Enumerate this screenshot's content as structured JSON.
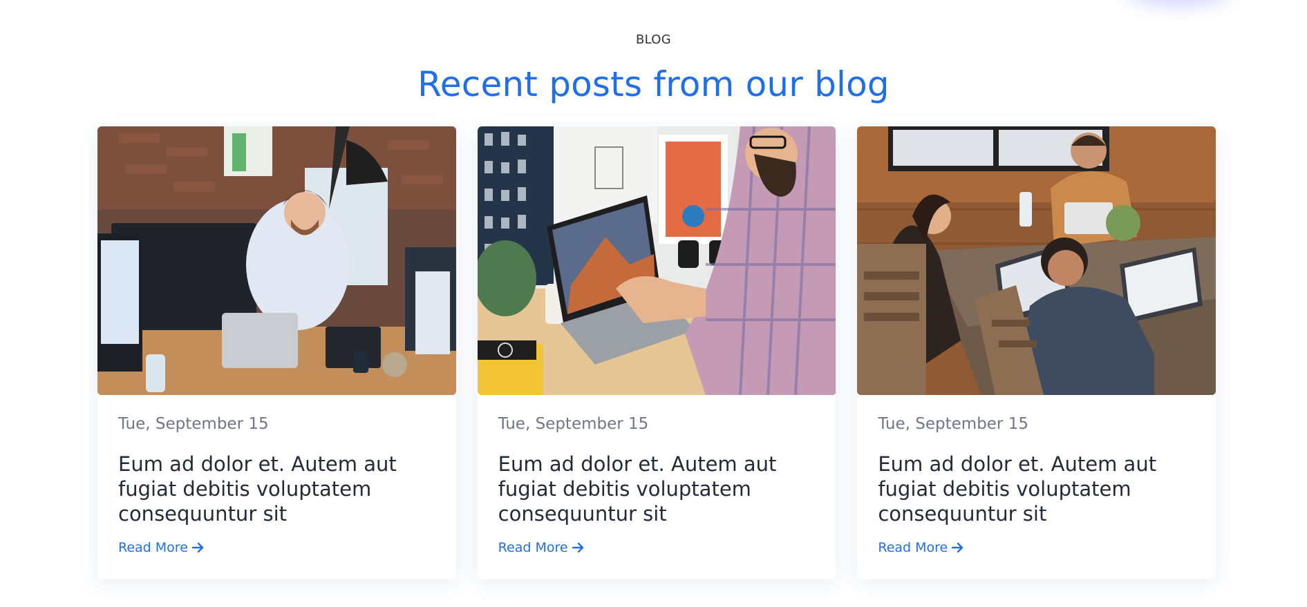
{
  "section": {
    "eyebrow": "BLOG",
    "heading": "Recent posts from our blog"
  },
  "posts": [
    {
      "date": "Tue, September 15",
      "title": "Eum ad dolor et. Autem aut fugiat debitis voluptatem consequuntur sit",
      "read_more": "Read More",
      "image": "office-headset-worker-photo"
    },
    {
      "date": "Tue, September 15",
      "title": "Eum ad dolor et. Autem aut fugiat debitis voluptatem consequuntur sit",
      "read_more": "Read More",
      "image": "laptop-desk-photo"
    },
    {
      "date": "Tue, September 15",
      "title": "Eum ad dolor et. Autem aut fugiat debitis voluptatem consequuntur sit",
      "read_more": "Read More",
      "image": "team-laptops-table-photo"
    }
  ],
  "colors": {
    "accent": "#1e6fe8",
    "date_text": "#6e7687",
    "title_text": "#232a38"
  }
}
